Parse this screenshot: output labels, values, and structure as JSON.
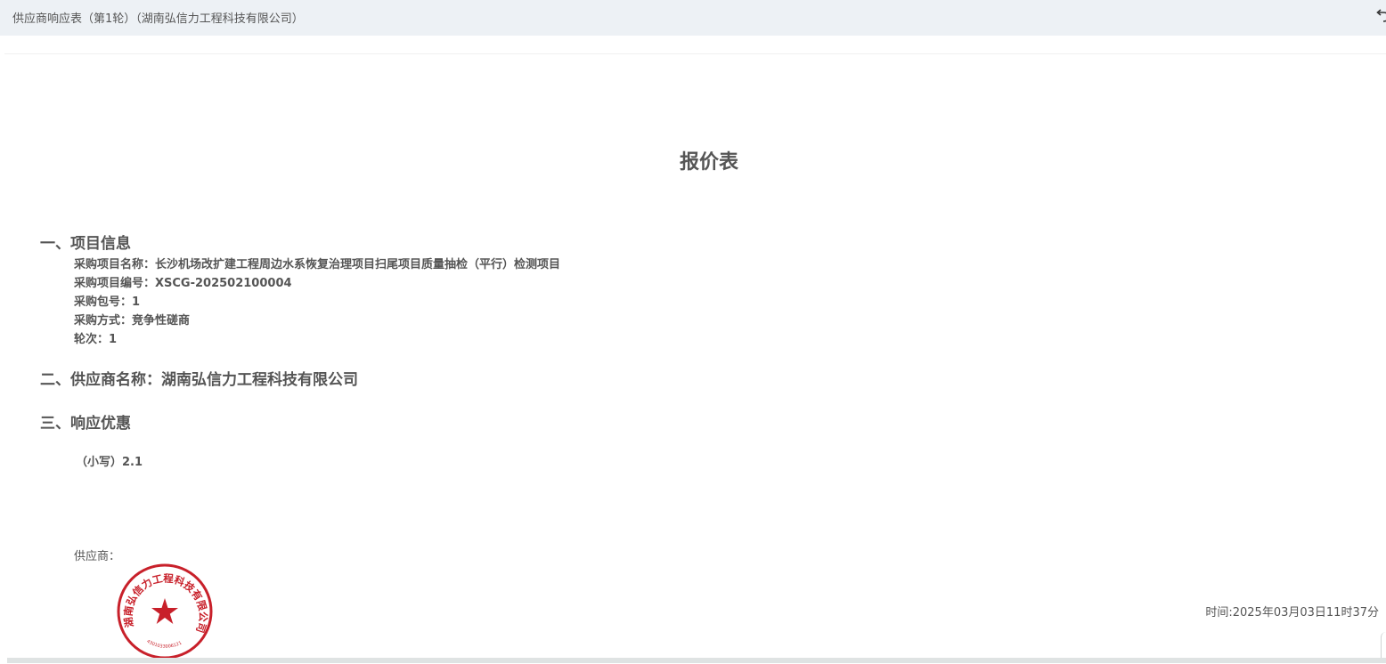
{
  "window": {
    "title": "供应商响应表（第1轮）（湖南弘信力工程科技有限公司）",
    "back_icon": "undo-arrow-icon"
  },
  "document": {
    "title": "报价表",
    "section1": {
      "heading": "一、项目信息",
      "lines": [
        "采购项目名称：长沙机场改扩建工程周边水系恢复治理项目扫尾项目质量抽检（平行）检测项目",
        "采购项目编号：XSCG-202502100004",
        "采购包号：1",
        "采购方式：竞争性磋商",
        "轮次：1"
      ]
    },
    "section2": {
      "heading": "二、供应商名称：湖南弘信力工程科技有限公司"
    },
    "section3": {
      "heading": "三、响应优惠",
      "price": "（小写）2.1"
    },
    "supplier_label": "供应商：",
    "seal": {
      "text": "湖南弘信力工程科技有限公司",
      "code": "4301033006121",
      "color": "#c8202a"
    },
    "timestamp": "时间:2025年03月03日11时37分"
  },
  "colors": {
    "titlebar_bg": "#edf1f5",
    "text": "#555555",
    "scrollbar": "#dfe3e3"
  }
}
